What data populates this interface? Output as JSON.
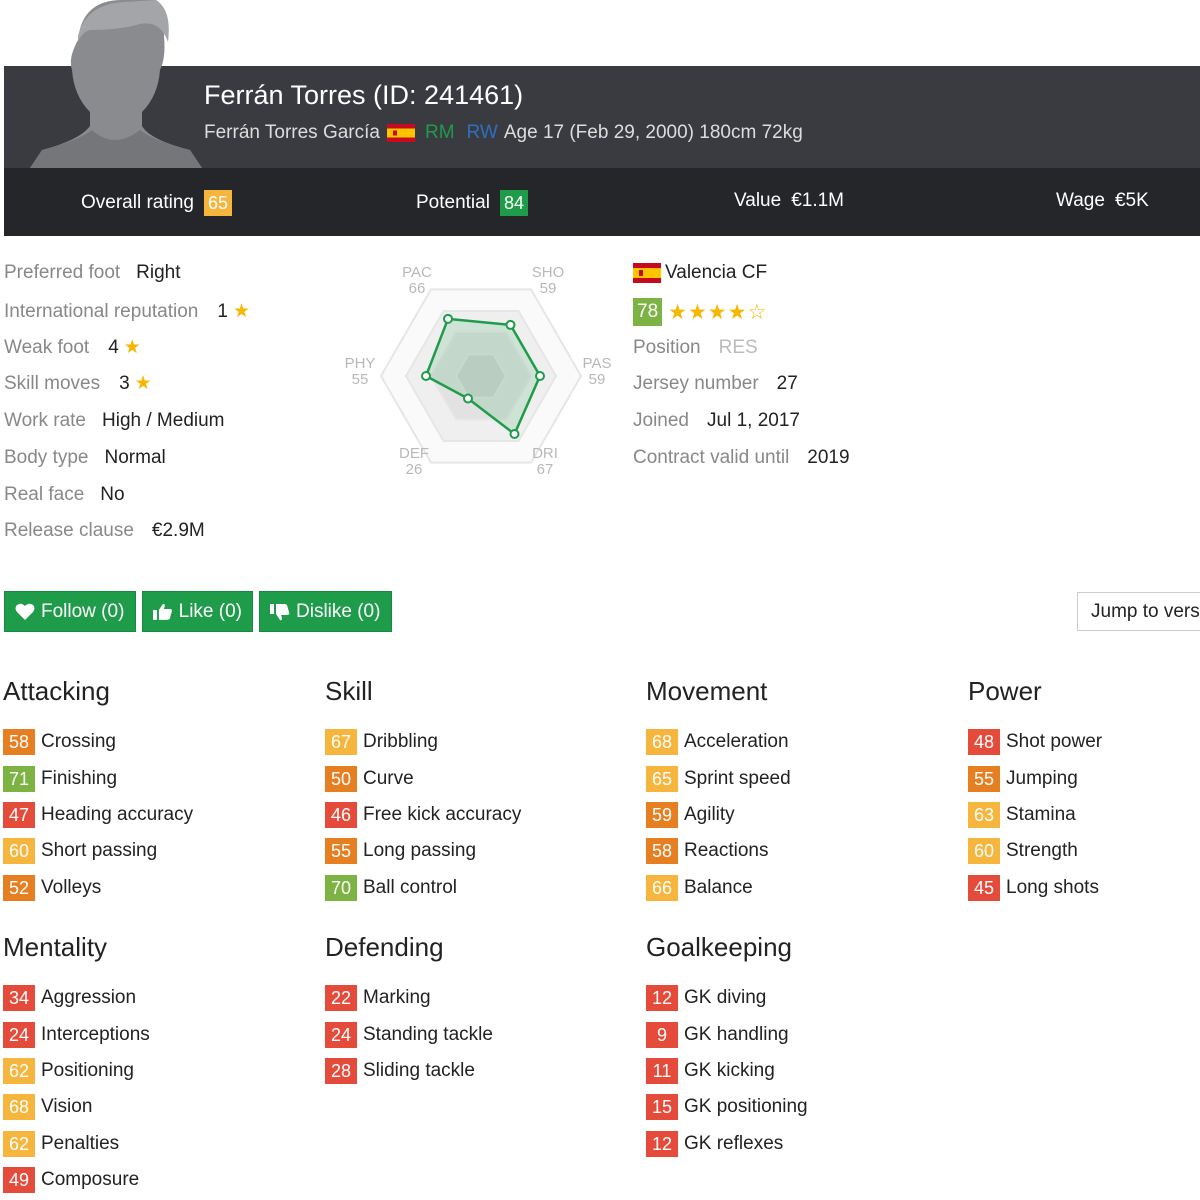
{
  "player": {
    "title": "Ferrán Torres (ID: 241461)",
    "full_name": "Ferrán Torres García",
    "pos1": "RM",
    "pos2": "RW",
    "bio": "Age 17 (Feb 29, 2000) 180cm 72kg",
    "pos1_color": "#1e9c4a",
    "pos2_color": "#2f6fc0"
  },
  "summary": {
    "overall_label": "Overall rating",
    "overall": "65",
    "overall_color": "#f6b53c",
    "potential_label": "Potential",
    "potential": "84",
    "potential_color": "#1e9c4a",
    "value_label": "Value",
    "value": "€1.1M",
    "wage_label": "Wage",
    "wage": "€5K"
  },
  "info": [
    {
      "label": "Preferred foot",
      "value": "Right"
    },
    {
      "label": "International reputation",
      "value": "1",
      "stars": 1
    },
    {
      "label": "Weak foot",
      "value": "4",
      "stars": 1
    },
    {
      "label": "Skill moves",
      "value": "3",
      "stars": 1
    },
    {
      "label": "Work rate",
      "value": "High / Medium"
    },
    {
      "label": "Body type",
      "value": "Normal"
    },
    {
      "label": "Real face",
      "value": "No"
    },
    {
      "label": "Release clause",
      "value": "€2.9M"
    }
  ],
  "radar": {
    "labels": [
      "PAC",
      "SHO",
      "PAS",
      "DRI",
      "DEF",
      "PHY"
    ],
    "values": [
      66,
      59,
      59,
      67,
      26,
      55
    ]
  },
  "club": {
    "name": "Valencia CF",
    "rating": "78",
    "rating_color": "#7cb342",
    "stars": 4,
    "stars_max": 5,
    "position_label": "Position",
    "position": "RES",
    "jersey_label": "Jersey number",
    "jersey": "27",
    "joined_label": "Joined",
    "joined": "Jul 1, 2017",
    "contract_label": "Contract valid until",
    "contract": "2019"
  },
  "actions": {
    "follow": "Follow (0)",
    "like": "Like (0)",
    "dislike": "Dislike (0)",
    "jump": "Jump to version"
  },
  "groups": [
    {
      "name": "Attacking",
      "attrs": [
        {
          "v": "58",
          "n": "Crossing"
        },
        {
          "v": "71",
          "n": "Finishing"
        },
        {
          "v": "47",
          "n": "Heading accuracy"
        },
        {
          "v": "60",
          "n": "Short passing"
        },
        {
          "v": "52",
          "n": "Volleys"
        }
      ]
    },
    {
      "name": "Skill",
      "attrs": [
        {
          "v": "67",
          "n": "Dribbling"
        },
        {
          "v": "50",
          "n": "Curve"
        },
        {
          "v": "46",
          "n": "Free kick accuracy"
        },
        {
          "v": "55",
          "n": "Long passing"
        },
        {
          "v": "70",
          "n": "Ball control"
        }
      ]
    },
    {
      "name": "Movement",
      "attrs": [
        {
          "v": "68",
          "n": "Acceleration"
        },
        {
          "v": "65",
          "n": "Sprint speed"
        },
        {
          "v": "59",
          "n": "Agility"
        },
        {
          "v": "58",
          "n": "Reactions"
        },
        {
          "v": "66",
          "n": "Balance"
        }
      ]
    },
    {
      "name": "Power",
      "attrs": [
        {
          "v": "48",
          "n": "Shot power"
        },
        {
          "v": "55",
          "n": "Jumping"
        },
        {
          "v": "63",
          "n": "Stamina"
        },
        {
          "v": "60",
          "n": "Strength"
        },
        {
          "v": "45",
          "n": "Long shots"
        }
      ]
    },
    {
      "name": "Mentality",
      "attrs": [
        {
          "v": "34",
          "n": "Aggression"
        },
        {
          "v": "24",
          "n": "Interceptions"
        },
        {
          "v": "62",
          "n": "Positioning"
        },
        {
          "v": "68",
          "n": "Vision"
        },
        {
          "v": "62",
          "n": "Penalties"
        },
        {
          "v": "49",
          "n": "Composure"
        }
      ]
    },
    {
      "name": "Defending",
      "attrs": [
        {
          "v": "22",
          "n": "Marking"
        },
        {
          "v": "24",
          "n": "Standing tackle"
        },
        {
          "v": "28",
          "n": "Sliding tackle"
        }
      ]
    },
    {
      "name": "Goalkeeping",
      "attrs": [
        {
          "v": "12",
          "n": "GK diving"
        },
        {
          "v": "9",
          "n": "GK handling"
        },
        {
          "v": "11",
          "n": "GK kicking"
        },
        {
          "v": "15",
          "n": "GK positioning"
        },
        {
          "v": "12",
          "n": "GK reflexes"
        }
      ]
    }
  ]
}
